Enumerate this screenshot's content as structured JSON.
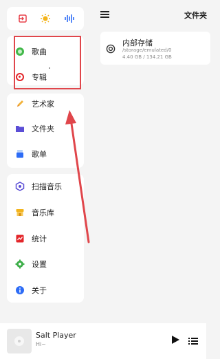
{
  "drawer": {
    "top_icons": [
      "exit-icon",
      "sun-icon",
      "waveform-icon"
    ],
    "library": [
      {
        "label": "歌曲",
        "icon": "song-disc-icon"
      },
      {
        "label": "专辑",
        "icon": "album-disc-icon"
      }
    ],
    "nav": [
      {
        "label": "艺术家",
        "icon": "pencil-icon"
      },
      {
        "label": "文件夹",
        "icon": "folder-icon"
      },
      {
        "label": "歌单",
        "icon": "playlist-icon"
      }
    ],
    "tools": [
      {
        "label": "扫描音乐",
        "icon": "scan-icon"
      },
      {
        "label": "音乐库",
        "icon": "store-icon"
      },
      {
        "label": "统计",
        "icon": "stats-icon"
      },
      {
        "label": "设置",
        "icon": "gear-icon"
      },
      {
        "label": "关于",
        "icon": "info-icon"
      }
    ]
  },
  "panel": {
    "title": "文件夹",
    "storage": {
      "name": "内部存储",
      "path": "/storage/emulated/0",
      "size": "4.40 GB / 134.21 GB"
    }
  },
  "player": {
    "title": "Salt Player",
    "subtitle": "Hi~"
  },
  "colors": {
    "annotation": "#e0464b",
    "accent_blue": "#2d6cf6",
    "song_green": "#42b84a",
    "album_red": "#e3262a"
  }
}
